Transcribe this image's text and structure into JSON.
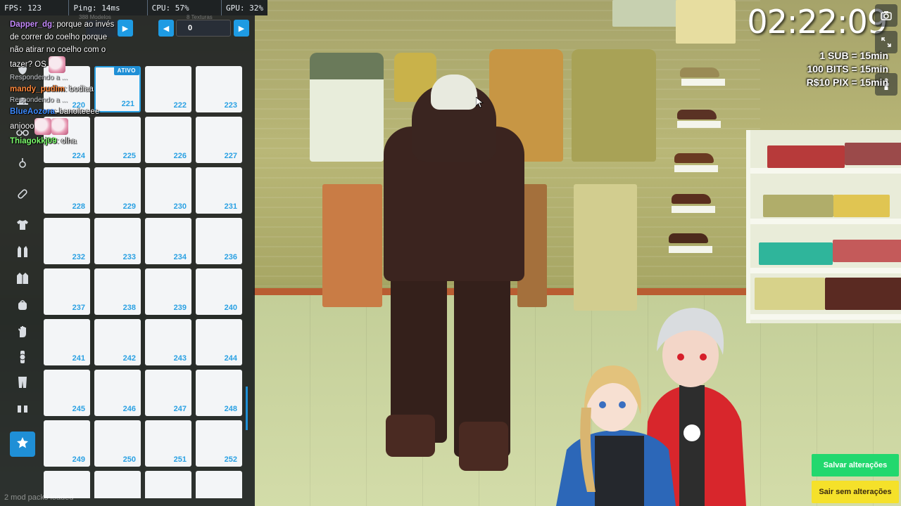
{
  "stats": {
    "fps": "FPS: 123",
    "ping": "Ping: 14ms",
    "cpu": "CPU: 57%",
    "gpu": "GPU: 32%"
  },
  "panel": {
    "models_label": "388 Modelos",
    "textures_label": "8 Texturas",
    "texture_value": "0",
    "prev_icon": "chevron-left-icon",
    "next_icon": "chevron-right-icon",
    "selected_badge": "ATIVO",
    "footer": "2 mod packs loaded",
    "items": [
      {
        "num": "220"
      },
      {
        "num": "221",
        "selected": true
      },
      {
        "num": "222"
      },
      {
        "num": "223"
      },
      {
        "num": "224"
      },
      {
        "num": "225"
      },
      {
        "num": "226"
      },
      {
        "num": "227"
      },
      {
        "num": "228"
      },
      {
        "num": "229"
      },
      {
        "num": "230"
      },
      {
        "num": "231"
      },
      {
        "num": "232"
      },
      {
        "num": "233"
      },
      {
        "num": "234"
      },
      {
        "num": "236"
      },
      {
        "num": "237"
      },
      {
        "num": "238"
      },
      {
        "num": "239"
      },
      {
        "num": "240"
      },
      {
        "num": "241"
      },
      {
        "num": "242"
      },
      {
        "num": "243"
      },
      {
        "num": "244"
      },
      {
        "num": "245"
      },
      {
        "num": "246"
      },
      {
        "num": "247"
      },
      {
        "num": "248"
      },
      {
        "num": "249"
      },
      {
        "num": "250"
      },
      {
        "num": "251"
      },
      {
        "num": "252"
      },
      {
        "num": ""
      },
      {
        "num": ""
      },
      {
        "num": ""
      },
      {
        "num": ""
      }
    ],
    "categories": [
      {
        "name": "mask-icon"
      },
      {
        "name": "hat-icon"
      },
      {
        "name": "glasses-icon"
      },
      {
        "name": "earring-icon"
      },
      {
        "name": "bandage-icon"
      },
      {
        "name": "tshirt-icon"
      },
      {
        "name": "vest-icon"
      },
      {
        "name": "jacket-icon"
      },
      {
        "name": "backpack-icon"
      },
      {
        "name": "glove-icon"
      },
      {
        "name": "watch-icon"
      },
      {
        "name": "pants-icon"
      },
      {
        "name": "shoes-icon"
      },
      {
        "name": "star-icon",
        "active": true
      }
    ]
  },
  "chat": {
    "messages": [
      {
        "user": "Dapper_dg",
        "color": "#c78cff",
        "text": ": porque ao invés de correr do coelho porque não atirar no coelho com o tazer?",
        "emote": "OS"
      },
      {
        "reply": "Respondendo a ...",
        "user": "mandy_pudim",
        "color": "#ff8a3d",
        "text": ": bodiaa"
      },
      {
        "reply": "Respondendo a ...",
        "user": "BlueAozora",
        "color": "#3d8bff",
        "text": ": banoiteeee anjooo"
      },
      {
        "user": "Thiagokkj09",
        "color": "#7dff6e",
        "text": ": olha"
      }
    ]
  },
  "clock": "02:22:09",
  "subs": [
    "1 SUB = 15min",
    "100 BITS = 15min",
    "R$10 PIX = 15min"
  ],
  "side_icons": [
    "camera-icon",
    "expand-icon",
    "person-icon"
  ],
  "buttons": {
    "save": "Salvar alterações",
    "exit": "Sair sem alterações"
  },
  "colors": {
    "accent": "#1f8fd6",
    "save": "#22d86e",
    "exit": "#f5e12a"
  }
}
